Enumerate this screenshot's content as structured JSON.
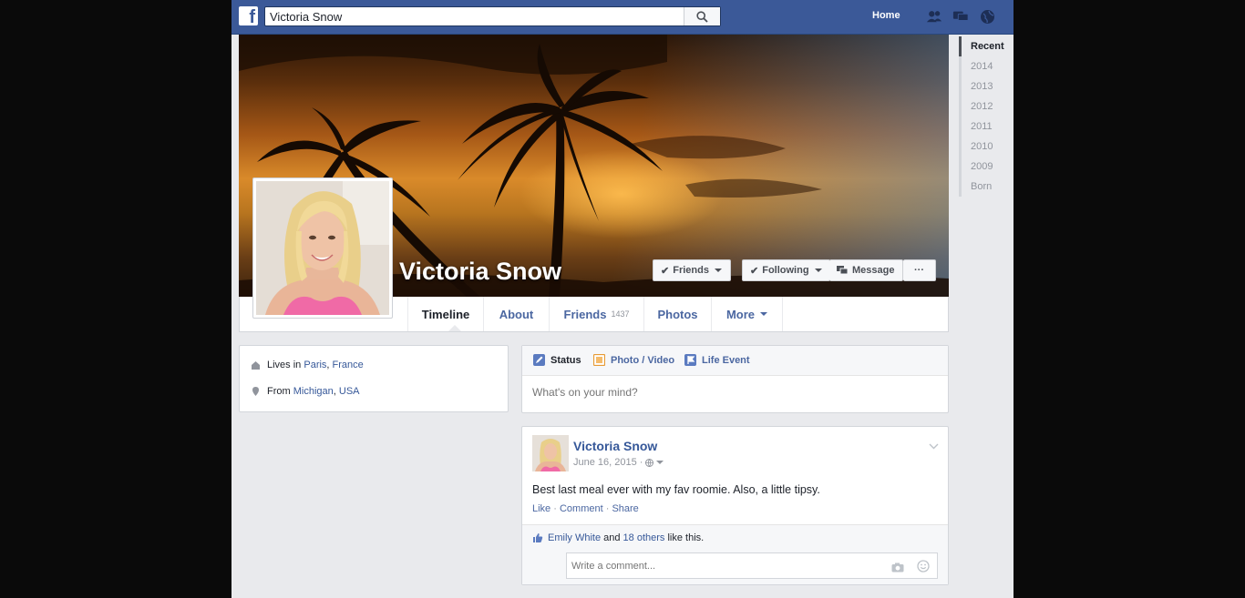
{
  "topbar": {
    "logo_letter": "f",
    "search_value": "Victoria Snow",
    "home_label": "Home"
  },
  "profile": {
    "name": "Victoria Snow",
    "buttons": {
      "friends": "Friends",
      "following": "Following",
      "message": "Message",
      "more": "···"
    }
  },
  "tabs": [
    {
      "label": "Timeline"
    },
    {
      "label": "About"
    },
    {
      "label": "Friends",
      "count": "1437"
    },
    {
      "label": "Photos"
    },
    {
      "label": "More"
    }
  ],
  "timeline_nav": [
    "Recent",
    "2014",
    "2013",
    "2012",
    "2011",
    "2010",
    "2009",
    "Born"
  ],
  "about": {
    "lives_prefix": "Lives in",
    "lives_city": "Paris",
    "lives_sep": ",",
    "lives_country": "France",
    "from_prefix": "From",
    "from_place": "Michigan",
    "from_sep": ",",
    "from_country": "USA"
  },
  "composer": {
    "status": "Status",
    "photo_video": "Photo / Video",
    "life_event": "Life Event",
    "placeholder": "What's on your mind?"
  },
  "post": {
    "author": "Victoria Snow",
    "date": "June 16, 2015",
    "date_sep": "·",
    "text": "Best last meal ever with my fav roomie. Also, a little tipsy.",
    "actions": {
      "like": "Like",
      "sep": " · ",
      "comment": "Comment",
      "share": "Share"
    },
    "likes": {
      "name": "Emily White",
      "and": "and",
      "others": "18 others",
      "suffix": "like this."
    },
    "comment_placeholder": "Write a comment..."
  },
  "colors": {
    "brand": "#3b5998",
    "link": "#365899",
    "page_bg": "#e9eaed"
  }
}
